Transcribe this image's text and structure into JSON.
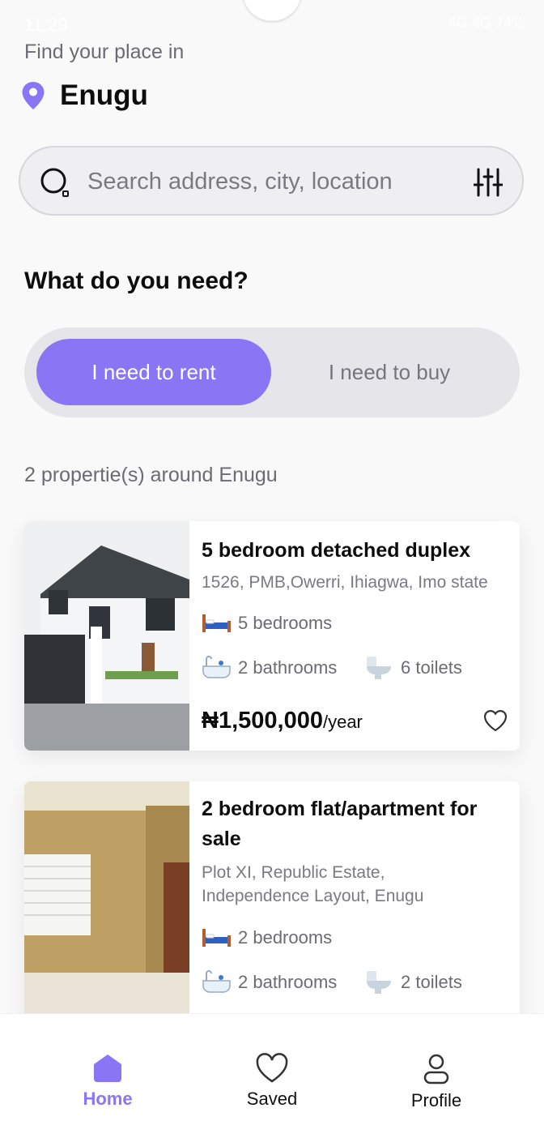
{
  "status_bar": {
    "time": "11:29",
    "right": "4G 4G 74%"
  },
  "header": {
    "find_label": "Find your place in",
    "city": "Enugu"
  },
  "search": {
    "placeholder": "Search address, city, location",
    "search_icon": "search-icon",
    "filter_icon": "filter-sliders-icon"
  },
  "need": {
    "heading": "What do you need?",
    "options": [
      "I need to rent",
      "I need to buy"
    ],
    "selected": "I need to rent"
  },
  "listing_count": "2 propertie(s) around Enugu",
  "properties": [
    {
      "title": "5 bedroom detached duplex",
      "address": "1526, PMB,Owerri, Ihiagwa, Imo state",
      "bedrooms": "5 bedrooms",
      "bathrooms": "2 bathrooms",
      "toilets": "6 toilets",
      "price": "₦1,500,000",
      "period": "/year"
    },
    {
      "title_line1": "2 bedroom flat/apartment for",
      "title_line2": "sale",
      "address_line1": "Plot XI, Republic Estate,",
      "address_line2": "Independence Layout, Enugu",
      "bedrooms": "2 bedrooms",
      "bathrooms": "2 bathrooms",
      "toilets": "2 toilets"
    }
  ],
  "nav": {
    "home": "Home",
    "saved": "Saved",
    "profile": "Profile"
  },
  "colors": {
    "accent": "#8a76f5",
    "background": "#f9f9fa",
    "muted_text": "#6b6b73"
  }
}
